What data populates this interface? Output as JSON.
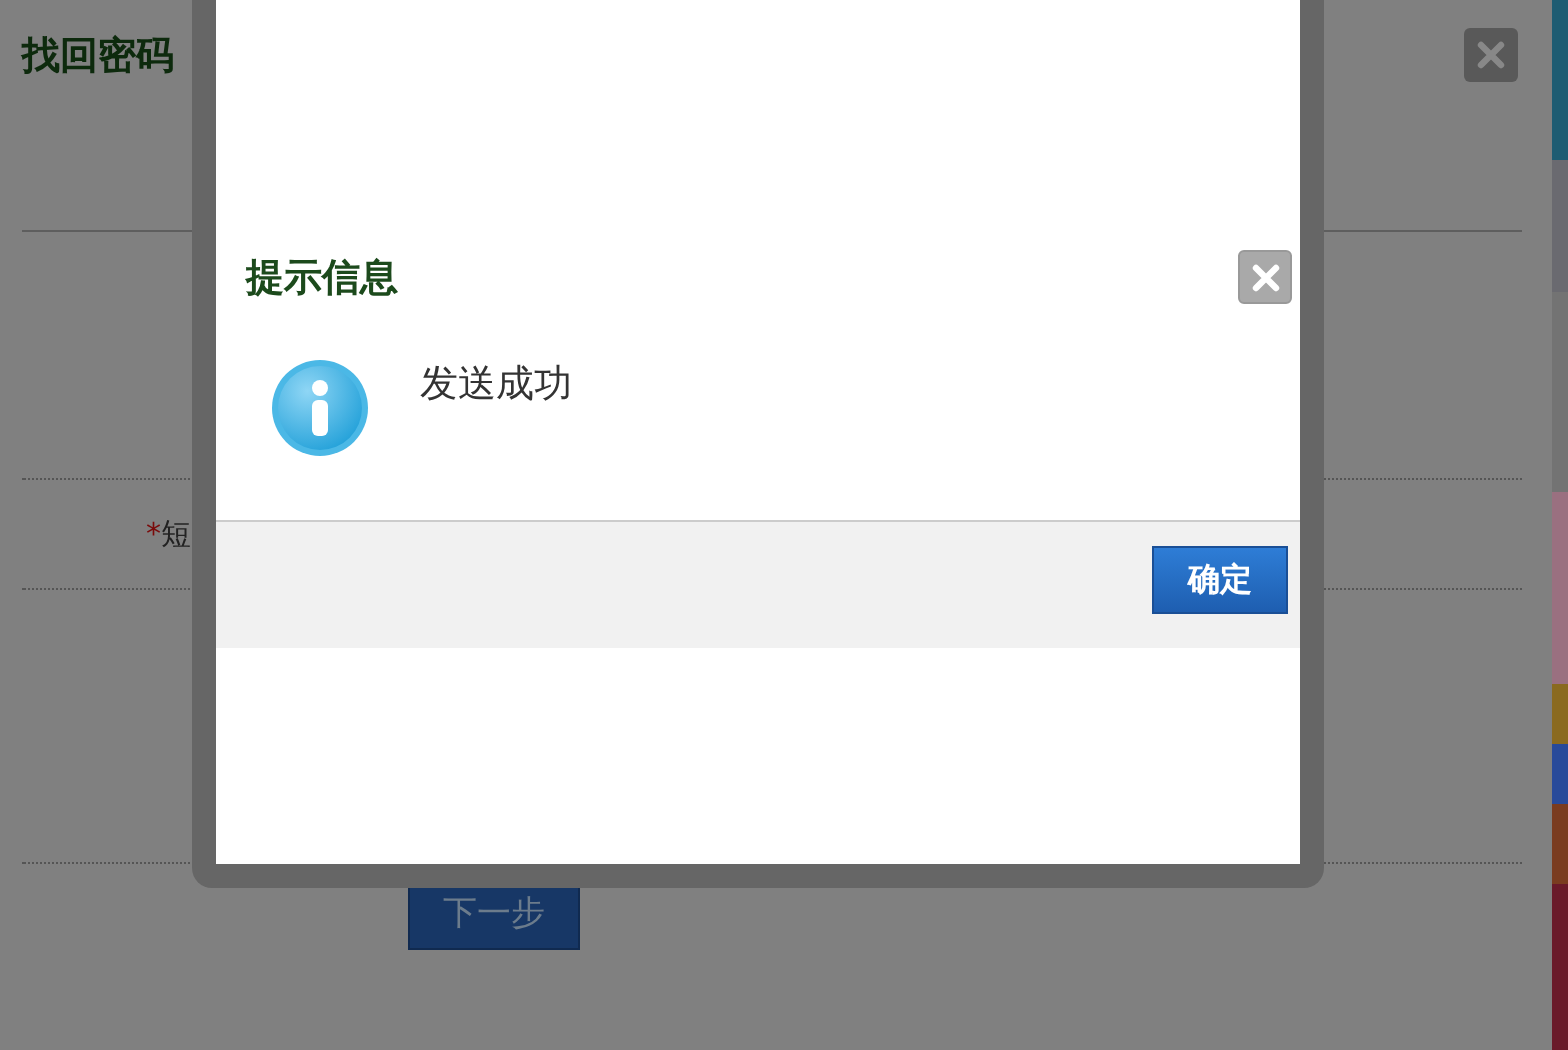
{
  "page": {
    "title": "找回密码",
    "fields": [
      {
        "required_mark": "*",
        "label": "短"
      }
    ],
    "next_button": "下一步"
  },
  "dialog": {
    "title": "提示信息",
    "message": "发送成功",
    "ok_button": "确定"
  }
}
